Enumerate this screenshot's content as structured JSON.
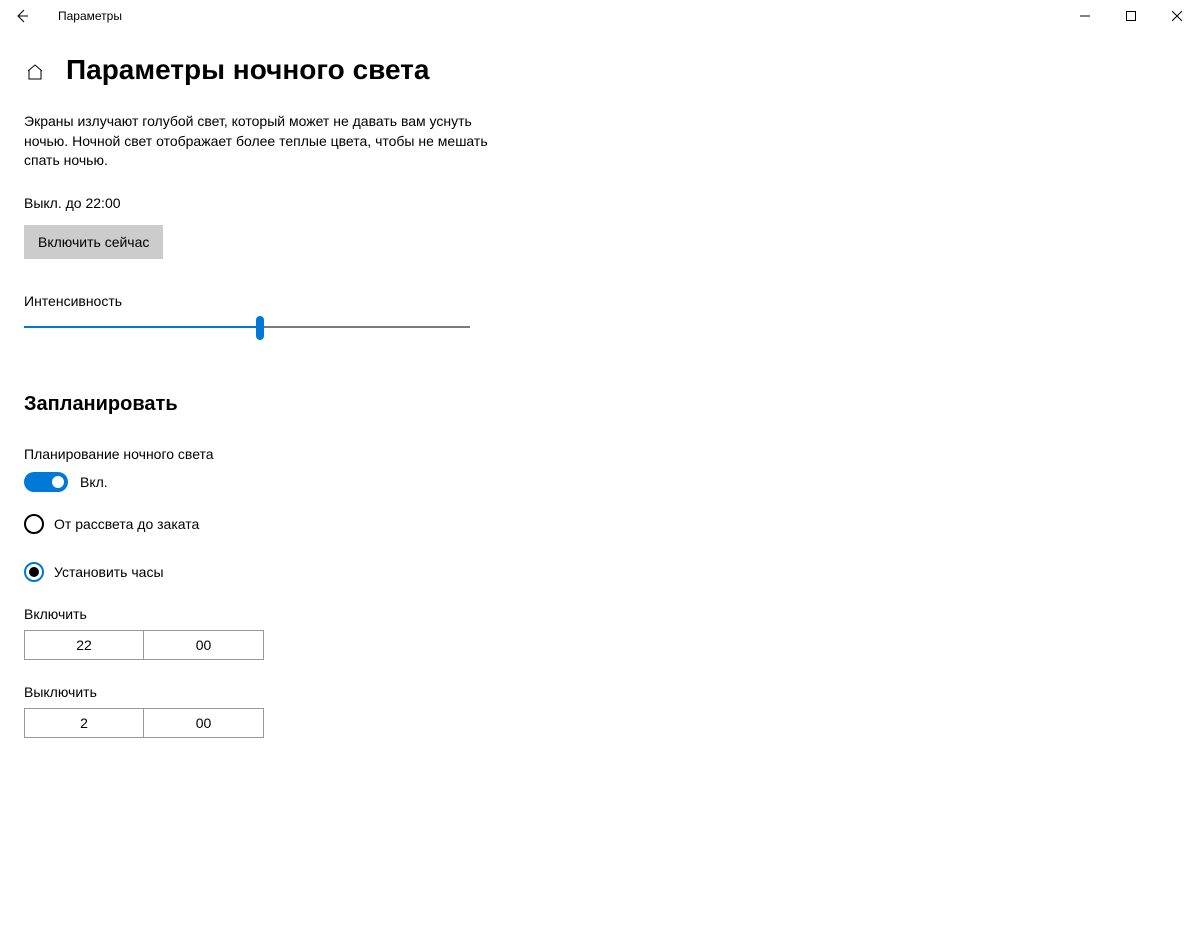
{
  "window": {
    "title": "Параметры"
  },
  "page": {
    "title": "Параметры ночного света",
    "description": "Экраны излучают голубой свет, который может не давать вам уснуть ночью. Ночной свет отображает более теплые цвета, чтобы не мешать спать ночью.",
    "status": "Выкл. до 22:00",
    "turn_on_now": "Включить сейчас",
    "intensity_label": "Интенсивность",
    "intensity_percent": 53
  },
  "schedule": {
    "title": "Запланировать",
    "plan_label": "Планирование ночного света",
    "toggle_state": "Вкл.",
    "options": {
      "sunset": "От рассвета до заката",
      "set_hours": "Установить часы"
    },
    "turn_on": {
      "label": "Включить",
      "hour": "22",
      "minute": "00"
    },
    "turn_off": {
      "label": "Выключить",
      "hour": "2",
      "minute": "00"
    }
  }
}
